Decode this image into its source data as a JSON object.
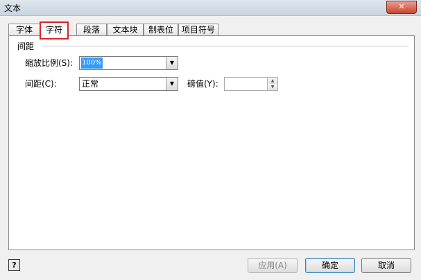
{
  "window": {
    "title": "文本",
    "close_symbol": "✕"
  },
  "tabs": [
    {
      "label": "字体"
    },
    {
      "label": "字符"
    },
    {
      "label": "段落"
    },
    {
      "label": "文本块"
    },
    {
      "label": "制表位"
    },
    {
      "label": "项目符号"
    }
  ],
  "group": {
    "title": "间距"
  },
  "scale": {
    "label": "缩放比例(S):",
    "value": "100%"
  },
  "spacing": {
    "label": "间距(C):",
    "value": "正常"
  },
  "pounds": {
    "label": "磅值(Y):",
    "value": ""
  },
  "buttons": {
    "help_symbol": "?",
    "apply": "应用(A)",
    "ok": "确定",
    "cancel": "取消"
  },
  "icons": {
    "dropdown": "▼",
    "spin_up": "▲",
    "spin_down": "▼"
  }
}
